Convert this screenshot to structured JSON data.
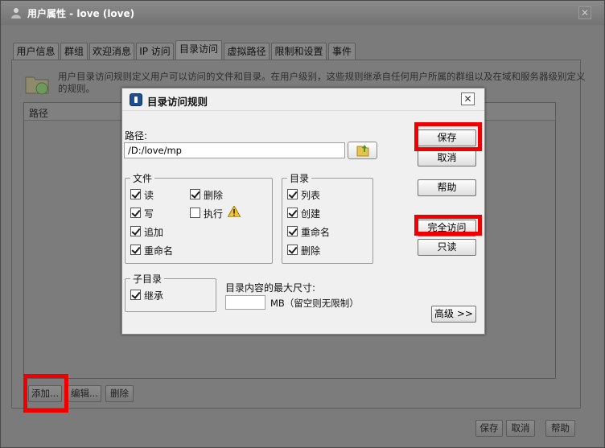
{
  "window": {
    "title": "用户属性  - love (love)",
    "close_glyph": "✕"
  },
  "tabs": [
    {
      "label": "用户信息"
    },
    {
      "label": "群组"
    },
    {
      "label": "欢迎消息"
    },
    {
      "label": "IP 访问"
    },
    {
      "label": "目录访问"
    },
    {
      "label": "虚拟路径"
    },
    {
      "label": "限制和设置"
    },
    {
      "label": "事件"
    }
  ],
  "active_tab": "目录访问",
  "panel": {
    "description": "用户目录访问规则定义用户可以访问的文件和目录。在用户级别，这些规则继承自任何用户所属的群组以及在域和服务器级别定义的规则。",
    "list_header": "路径"
  },
  "bottom_left_buttons": {
    "add": "添加...",
    "edit": "编辑...",
    "delete": "删除"
  },
  "bottom_right_buttons": {
    "save": "保存",
    "cancel": "取消",
    "help": "帮助"
  },
  "dialog": {
    "title": "目录访问规则",
    "close_glyph": "✕",
    "path_label": "路径:",
    "path_value": "/D:/love/mp",
    "files_group": {
      "title": "文件",
      "read": {
        "label": "读",
        "checked": true
      },
      "write": {
        "label": "写",
        "checked": true
      },
      "append": {
        "label": "追加",
        "checked": true
      },
      "rename": {
        "label": "重命名",
        "checked": true
      },
      "delete": {
        "label": "删除",
        "checked": true
      },
      "execute": {
        "label": "执行",
        "checked": false
      }
    },
    "dirs_group": {
      "title": "目录",
      "list": {
        "label": "列表",
        "checked": true
      },
      "create": {
        "label": "创建",
        "checked": true
      },
      "rename": {
        "label": "重命名",
        "checked": true
      },
      "delete": {
        "label": "删除",
        "checked": true
      }
    },
    "subdir_group": {
      "title": "子目录",
      "inherit": {
        "label": "继承",
        "checked": true
      }
    },
    "max_size_label": "目录内容的最大尺寸:",
    "max_size_value": "",
    "max_size_unit": "MB（留空则无限制）",
    "buttons": {
      "save": "保存",
      "cancel": "取消",
      "help": "帮助",
      "full_access": "完全访问",
      "read_only": "只读",
      "advanced": "高级 >>"
    }
  },
  "highlight_color": "#ee0000"
}
